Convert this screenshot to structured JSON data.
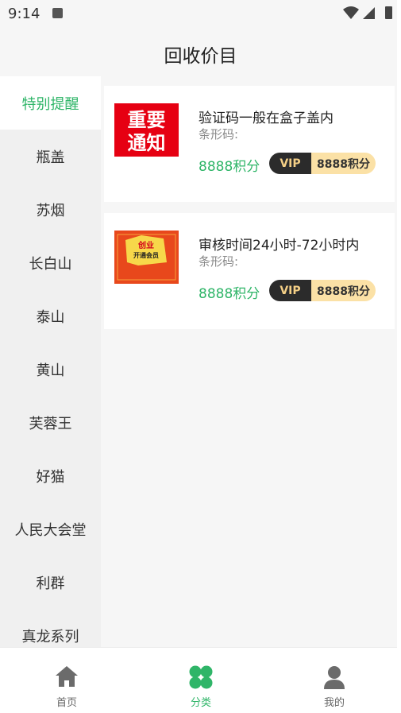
{
  "status_bar": {
    "time": "9:14",
    "icons": [
      "a-notification-icon",
      "wifi-icon",
      "signal-icon",
      "battery-icon"
    ]
  },
  "header": {
    "title": "回收价目"
  },
  "sidebar": {
    "items": [
      {
        "label": "特别提醒",
        "active": true
      },
      {
        "label": "瓶盖"
      },
      {
        "label": "苏烟"
      },
      {
        "label": "长白山"
      },
      {
        "label": "泰山"
      },
      {
        "label": "黄山"
      },
      {
        "label": "芙蓉王"
      },
      {
        "label": "好猫"
      },
      {
        "label": "人民大会堂"
      },
      {
        "label": "利群"
      },
      {
        "label": "真龙系列"
      }
    ]
  },
  "products": [
    {
      "title": "验证码一般在盒子盖内",
      "barcode_label": "条形码:",
      "points": "8888积分",
      "vip_label": "VIP",
      "vip_points": "8888积分",
      "thumb_text": [
        "重要",
        "通知"
      ]
    },
    {
      "title": "审核时间24小时-72小时内",
      "barcode_label": "条形码:",
      "points": "8888积分",
      "vip_label": "VIP",
      "vip_points": "8888积分",
      "thumb_text": [
        "创业",
        "开通会员"
      ]
    }
  ],
  "bottom_nav": [
    {
      "label": "首页",
      "icon": "home-icon"
    },
    {
      "label": "分类",
      "icon": "clover-icon",
      "active": true
    },
    {
      "label": "我的",
      "icon": "user-icon"
    }
  ],
  "colors": {
    "accent": "#2fb568",
    "vip_dark": "#2b2b2b",
    "vip_gold": "#fbe1a6",
    "notice_red": "#e60012"
  }
}
